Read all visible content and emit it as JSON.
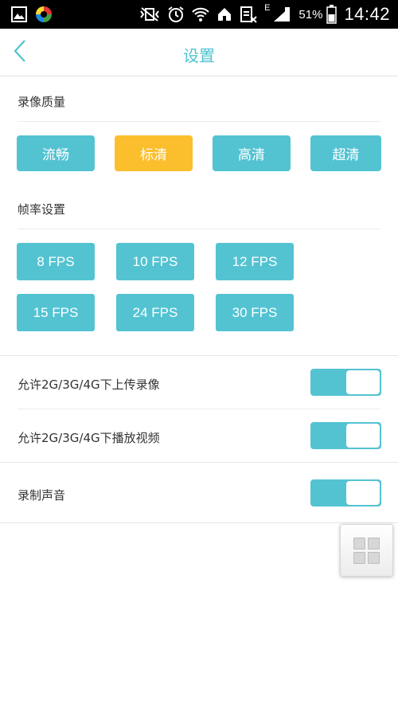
{
  "status_bar": {
    "battery_percent": "51%",
    "time": "14:42",
    "network_label": "E",
    "icons": [
      "gallery-icon",
      "app-pinwheel-icon",
      "mute-vibrate-icon",
      "alarm-icon",
      "wifi-icon",
      "home-icon",
      "data-transfer-icon",
      "signal-icon",
      "battery-icon"
    ]
  },
  "header": {
    "title": "设置",
    "back_icon": "chevron-left-icon"
  },
  "video_quality": {
    "label": "录像质量",
    "options": [
      "流畅",
      "标清",
      "高清",
      "超清"
    ],
    "selected": "标清"
  },
  "frame_rate": {
    "label": "帧率设置",
    "options": [
      "8 FPS",
      "10 FPS",
      "12 FPS",
      "15 FPS",
      "24 FPS",
      "30 FPS"
    ]
  },
  "toggles": [
    {
      "label": "允许2G/3G/4G下上传录像",
      "on": true
    },
    {
      "label": "允许2G/3G/4G下播放视频",
      "on": true
    },
    {
      "label": "录制声音",
      "on": true
    }
  ],
  "colors": {
    "accent": "#53c3d2",
    "selected": "#fbbe2c",
    "title": "#4fc3d0"
  },
  "floating_button_icon": "grid-menu-icon"
}
